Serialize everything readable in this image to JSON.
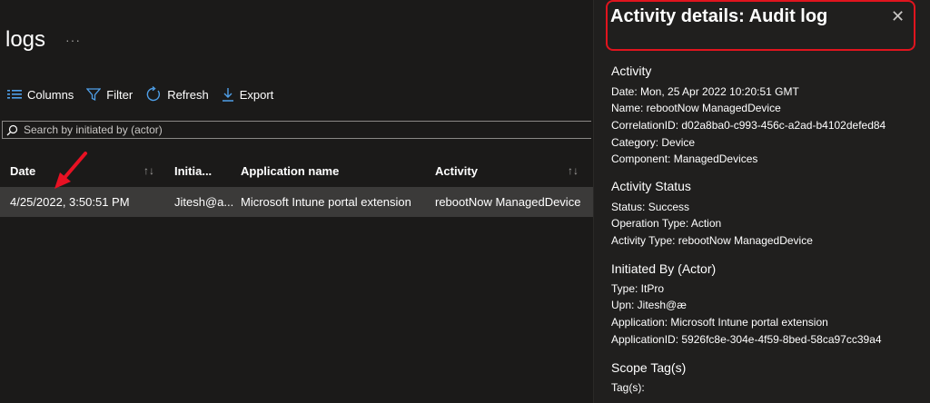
{
  "page": {
    "title": "logs",
    "more": "···"
  },
  "toolbar": {
    "columns": "Columns",
    "filter": "Filter",
    "refresh": "Refresh",
    "export": "Export"
  },
  "search": {
    "placeholder": "Search by initiated by (actor)"
  },
  "table": {
    "headers": [
      "Date",
      "Initia...",
      "Application name",
      "Activity"
    ],
    "sort_glyph": "↑↓",
    "rows": [
      {
        "date": "4/25/2022, 3:50:51 PM",
        "initiated": "Jitesh@a...",
        "application": "Microsoft Intune portal extension",
        "activity": "rebootNow ManagedDevice"
      }
    ]
  },
  "details": {
    "title": "Activity details: Audit log",
    "close": "✕",
    "sections": [
      {
        "heading": "Activity",
        "lines": [
          "Date: Mon, 25 Apr 2022 10:20:51 GMT",
          "Name: rebootNow ManagedDevice",
          "CorrelationID: d02a8ba0-c993-456c-a2ad-b4102defed84",
          "Category: Device",
          "Component: ManagedDevices"
        ]
      },
      {
        "heading": "Activity Status",
        "lines": [
          "Status: Success",
          "Operation Type: Action",
          "Activity Type: rebootNow ManagedDevice"
        ]
      },
      {
        "heading": "Initiated By (Actor)",
        "lines": [
          "Type: ItPro",
          "Upn: Jitesh@æ",
          "Application: Microsoft Intune portal extension",
          "ApplicationID: 5926fc8e-304e-4f59-8bed-58ca97cc39a4"
        ]
      },
      {
        "heading": "Scope Tag(s)",
        "lines": [
          "Tag(s):"
        ]
      }
    ]
  },
  "colors": {
    "accent": "#0078d4",
    "highlight": "#e0141e",
    "annotation_arrow": "#e81123"
  }
}
